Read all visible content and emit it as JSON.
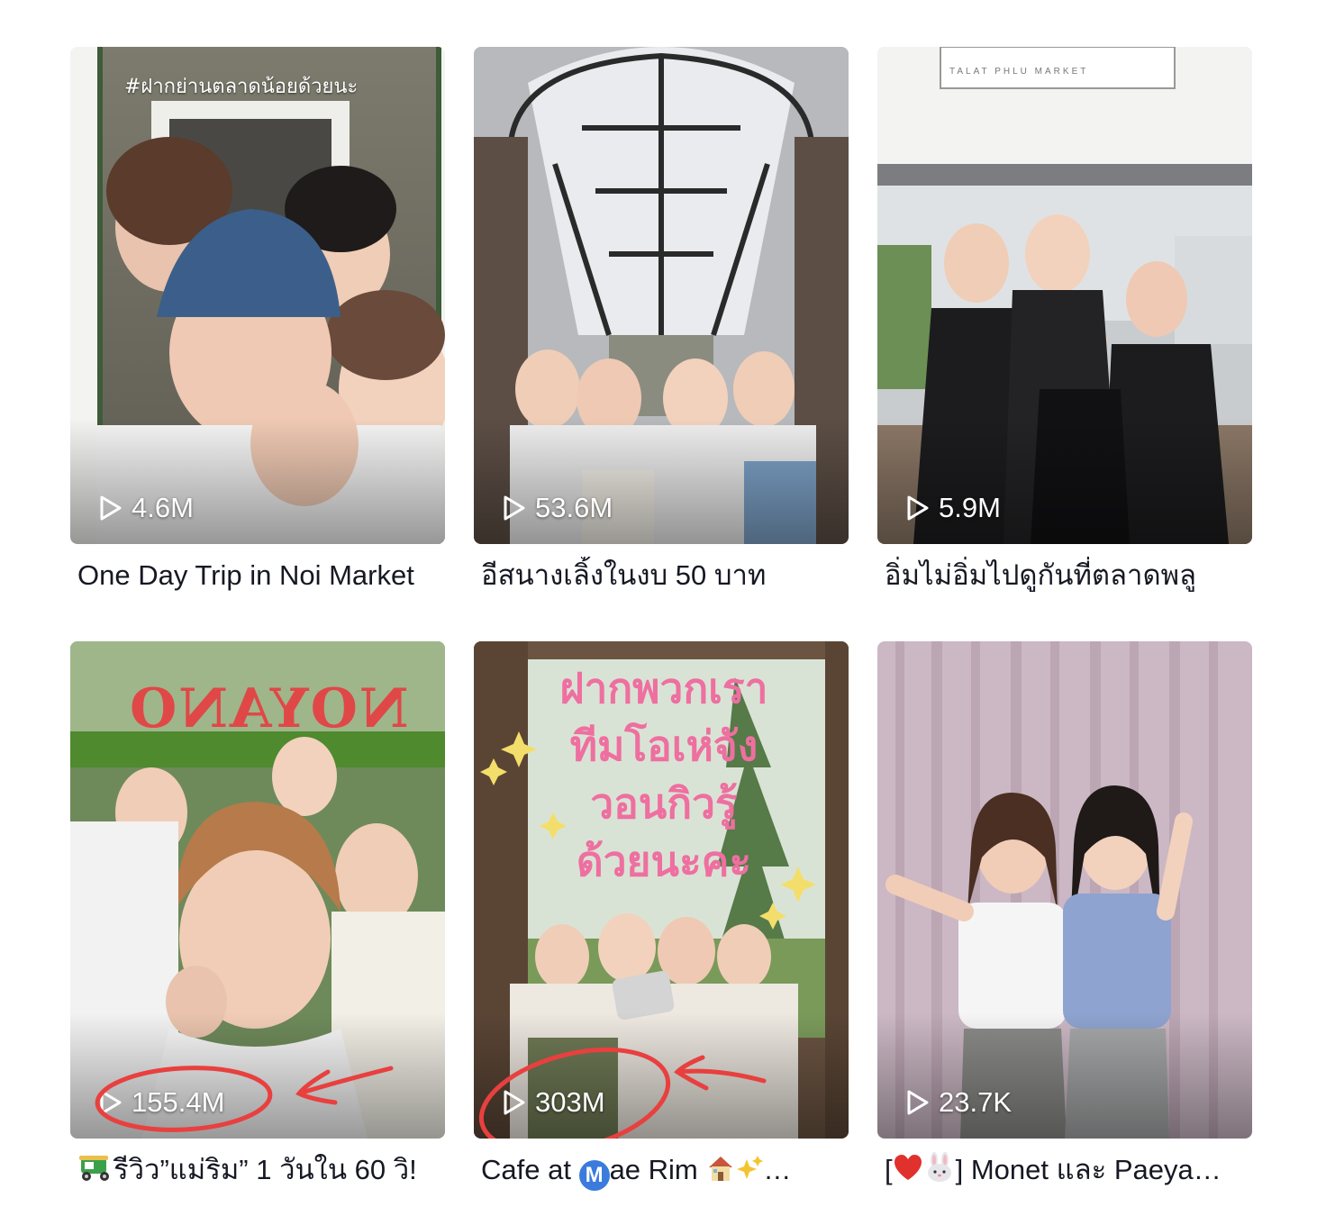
{
  "videos": [
    {
      "views": "4.6M",
      "caption": "One Day Trip in Noi Market"
    },
    {
      "views": "53.6M",
      "caption": "อีสนางเลิ้งในงบ 50 บาท"
    },
    {
      "views": "5.9M",
      "caption": "อิ่มไม่อิ่มไปดูกันที่ตลาดพลู"
    },
    {
      "views": "155.4M",
      "caption_text": "รีวิว”แม่ริม” 1 วันใน 60 วิ!"
    },
    {
      "views": "303M",
      "caption_pre": "Cafe at ",
      "caption_badge": "M",
      "caption_post": "ae Rim ",
      "caption_ellipsis": "…"
    },
    {
      "views": "23.7K",
      "caption_open": "[",
      "caption_close": "] Monet และ Paeya…"
    }
  ],
  "thumbnail_text": {
    "video1_overlay": "#ฝากย่านตลาดน้อยด้วยนะ",
    "video3_sign": "TALAT PHLU MARKET",
    "video4_sign": "NOYANO",
    "video5_handwriting": [
      "ฝากพวกเรา",
      "ทีมโอเห่จัง",
      "วอนกิวรู้",
      "ด้วยนะคะ"
    ]
  },
  "annotation_color": "#e8403f"
}
